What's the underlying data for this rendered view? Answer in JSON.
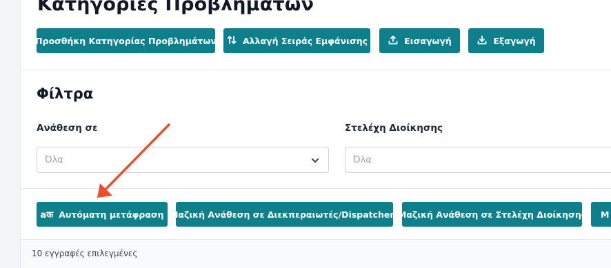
{
  "header": {
    "title": "Κατηγορίες Προβλημάτων"
  },
  "top_actions": {
    "add_category": "Προσθήκη Κατηγορίας Προβλημάτων",
    "change_order": "Αλλαγή Σειράς Εμφάνισης",
    "import": "Εισαγωγή",
    "export": "Εξαγωγή"
  },
  "filters": {
    "heading": "Φίλτρα",
    "assigned_to": {
      "label": "Ανάθεση σε",
      "value": "Όλα"
    },
    "management_staff": {
      "label": "Στελέχη Διοίκησης",
      "value": "Όλα"
    }
  },
  "bulk_actions": {
    "auto_translate": "Αυτόματη μετάφραση",
    "assign_dispatchers": "Μαζική Ανάθεση σε Διεκπεραιωτές/Dispatchers",
    "assign_management": "Μαζική Ανάθεση σε Στελέχη Διοίκησης",
    "next_partial": "Μ"
  },
  "footer": {
    "selected_count": "10 εγγραφές επιλεγμένες"
  },
  "colors": {
    "primary": "#0f7f8c",
    "annotation": "#e8502f"
  },
  "icons": {
    "change_order": "sort-arrows-icon",
    "import": "upload-icon",
    "export": "download-icon",
    "auto_translate": "translate-icon",
    "select": "chevron-down-icon"
  }
}
